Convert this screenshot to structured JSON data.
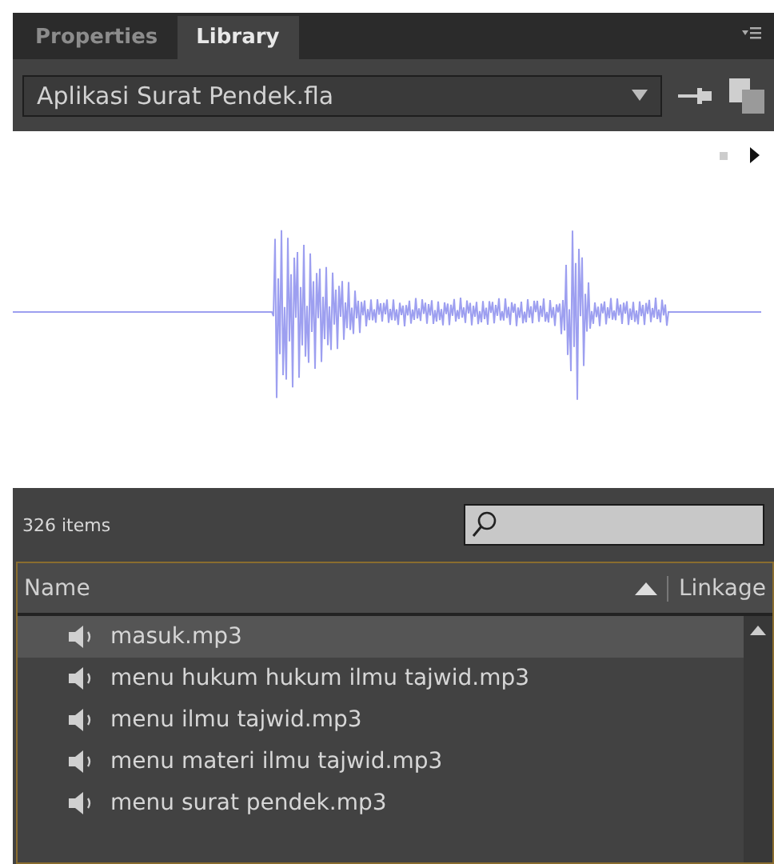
{
  "tabs": [
    {
      "label": "Properties",
      "selected": false
    },
    {
      "label": "Library",
      "selected": true
    }
  ],
  "document": {
    "value": "Aplikasi Surat Pendek.fla"
  },
  "status": {
    "count": "326 items"
  },
  "table": {
    "columns": [
      "Name",
      "Linkage"
    ],
    "rows": [
      {
        "name": "masuk.mp3",
        "selected": true
      },
      {
        "name": "menu hukum hukum ilmu tajwid.mp3",
        "selected": false
      },
      {
        "name": "menu ilmu tajwid.mp3",
        "selected": false
      },
      {
        "name": "menu materi ilmu tajwid.mp3",
        "selected": false
      },
      {
        "name": "menu surat pendek.mp3",
        "selected": false
      }
    ]
  }
}
